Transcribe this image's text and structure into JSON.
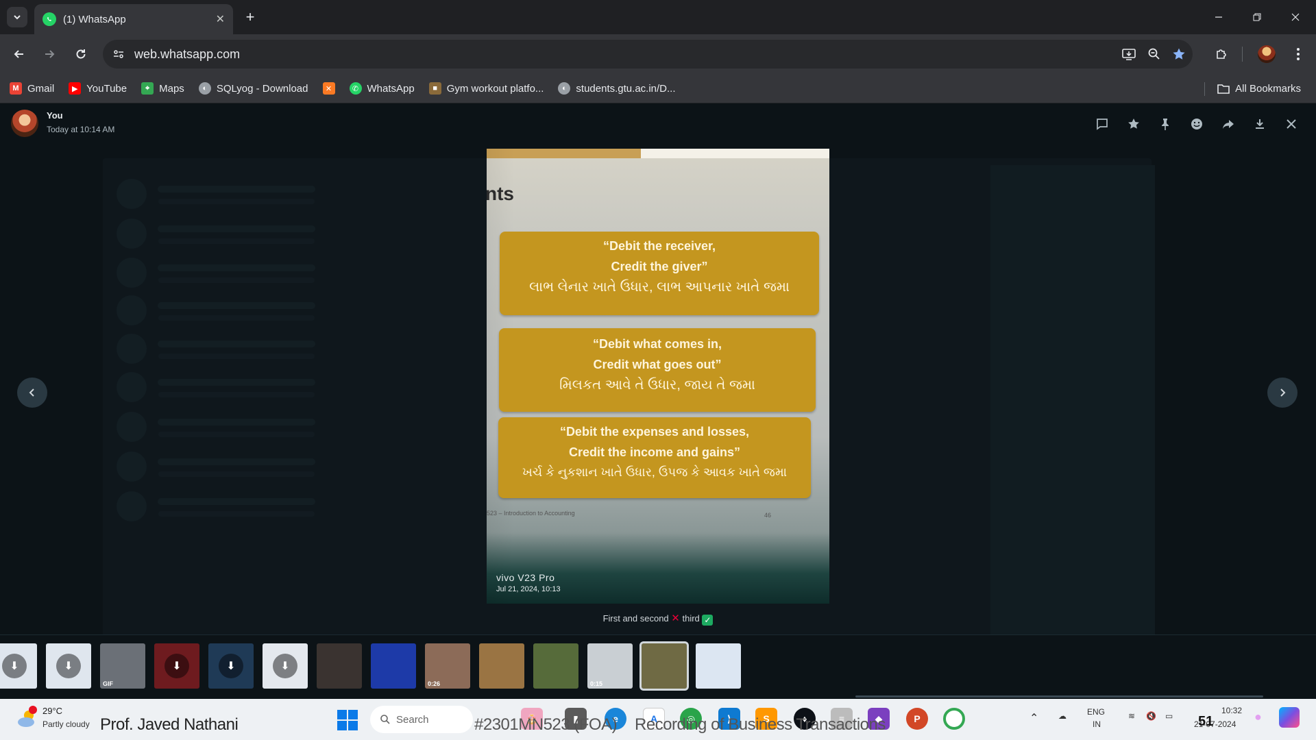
{
  "browser": {
    "tab_title": "(1) WhatsApp",
    "url": "web.whatsapp.com",
    "bookmarks": [
      {
        "label": "Gmail",
        "icon": "gmail-icon",
        "color": "#ea4335"
      },
      {
        "label": "YouTube",
        "icon": "youtube-icon",
        "color": "#ff0000"
      },
      {
        "label": "Maps",
        "icon": "maps-icon",
        "color": "#34a853"
      },
      {
        "label": "SQLyog - Download",
        "icon": "globe-icon",
        "color": "#9aa0a6"
      },
      {
        "label": "",
        "icon": "xampp-icon",
        "color": "#fb7a24"
      },
      {
        "label": "WhatsApp",
        "icon": "whatsapp-icon",
        "color": "#25d366"
      },
      {
        "label": "Gym workout platfo...",
        "icon": "gym-icon",
        "color": "#8a6a3a"
      },
      {
        "label": "students.gtu.ac.in/D...",
        "icon": "globe-icon",
        "color": "#9aa0a6"
      }
    ],
    "all_bookmarks": "All Bookmarks"
  },
  "viewer": {
    "sender": "You",
    "timestamp": "Today at 10:14 AM",
    "caption_part1": "First and second",
    "caption_part2": "third",
    "photo": {
      "slide_heading": "nts",
      "cards": [
        {
          "en1": "“Debit the receiver,",
          "en2": "Credit the giver”",
          "gu": "લાભ લેનાર ખાતે ઉધાર, લાભ આપનાર ખાતે જમા"
        },
        {
          "en1": "“Debit what comes in,",
          "en2": "Credit what goes out”",
          "gu": "મિલકત આવે તે ઉધાર, જાય તે જમા"
        },
        {
          "en1": "“Debit the expenses and losses,",
          "en2": "Credit the income and gains”",
          "gu": "ખર્ચ કે નુકશાન ખાતે ઉધાર, ઉપજ કે આવક ખાતે જમા"
        }
      ],
      "slide_footer": "523 – Introduction to Accounting",
      "slide_number": "46",
      "watermark_device": "vivo V23 Pro",
      "watermark_date": "Jul 21, 2024, 10:13"
    },
    "thumbs": [
      {
        "kind": "download",
        "bg": "#dfe6ee",
        "badge": ""
      },
      {
        "kind": "download",
        "bg": "#dfe6ee",
        "badge": ""
      },
      {
        "kind": "photo",
        "bg": "#6b7077",
        "badge": "GIF"
      },
      {
        "kind": "download",
        "bg": "#6e1b1f",
        "badge": ""
      },
      {
        "kind": "download",
        "bg": "#1f3a56",
        "badge": ""
      },
      {
        "kind": "download",
        "bg": "#e4e8ee",
        "badge": ""
      },
      {
        "kind": "photo",
        "bg": "#3a3330",
        "badge": ""
      },
      {
        "kind": "photo",
        "bg": "#1d3aa8",
        "badge": ""
      },
      {
        "kind": "video",
        "bg": "#8c6b58",
        "badge": "0:26"
      },
      {
        "kind": "photo",
        "bg": "#9a7443",
        "badge": ""
      },
      {
        "kind": "photo",
        "bg": "#566b3a",
        "badge": ""
      },
      {
        "kind": "video",
        "bg": "#c9cfd3",
        "badge": "0:15"
      },
      {
        "kind": "photo",
        "bg": "#6f6a44",
        "badge": "",
        "selected": true
      },
      {
        "kind": "photo",
        "bg": "#dce6f2",
        "badge": ""
      }
    ]
  },
  "taskbar": {
    "weather_temp": "29°C",
    "weather_desc": "Partly cloudy",
    "overlay_name": "Prof. Javed Nathani",
    "overlay_course": "#2301MN523 (FOA)",
    "overlay_rec": "Recording of Business Transactions",
    "search": "Search",
    "lang1": "ENG",
    "lang2": "IN",
    "time": "10:32",
    "date": "21-07-2024",
    "overlay_code": "51"
  }
}
